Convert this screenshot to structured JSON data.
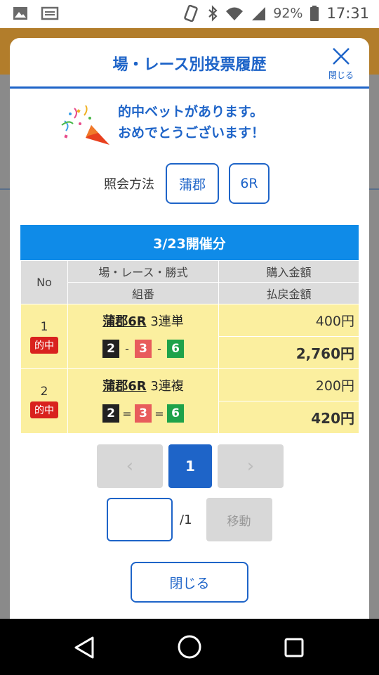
{
  "status_bar": {
    "battery": "92%",
    "time": "17:31"
  },
  "modal": {
    "title": "場・レース別投票履歴",
    "close_x_label": "閉じる",
    "congrats_line1": "的中ベットがあります。",
    "congrats_line2": "おめでとうございます！",
    "query_label": "照会方法",
    "query_venue": "蒲郡",
    "query_race": "6R",
    "date_header": "3/23開催分",
    "table_headers": {
      "no": "No",
      "race": "場・レース・勝式",
      "purchase": "購入金額",
      "combo": "組番",
      "payout": "払戻金額"
    },
    "rows": [
      {
        "no": "1",
        "badge": "的中",
        "race_link": "蒲郡6R",
        "bet_type": "3連単",
        "combo": [
          "2",
          "3",
          "6"
        ],
        "separator": "-",
        "purchase": "400円",
        "payout": "2,760円"
      },
      {
        "no": "2",
        "badge": "的中",
        "race_link": "蒲郡6R",
        "bet_type": "3連複",
        "combo": [
          "2",
          "3",
          "6"
        ],
        "separator": "=",
        "purchase": "200円",
        "payout": "420円"
      }
    ],
    "pager": {
      "prev": "‹",
      "current": "1",
      "next": "›"
    },
    "goto": {
      "total": "/1",
      "button": "移動"
    },
    "close_button": "閉じる"
  },
  "colors": {
    "accent": "#1e64c8",
    "date_bar": "#0f8be8",
    "row_bg": "#fbef9f",
    "hit_badge": "#d9221e"
  }
}
